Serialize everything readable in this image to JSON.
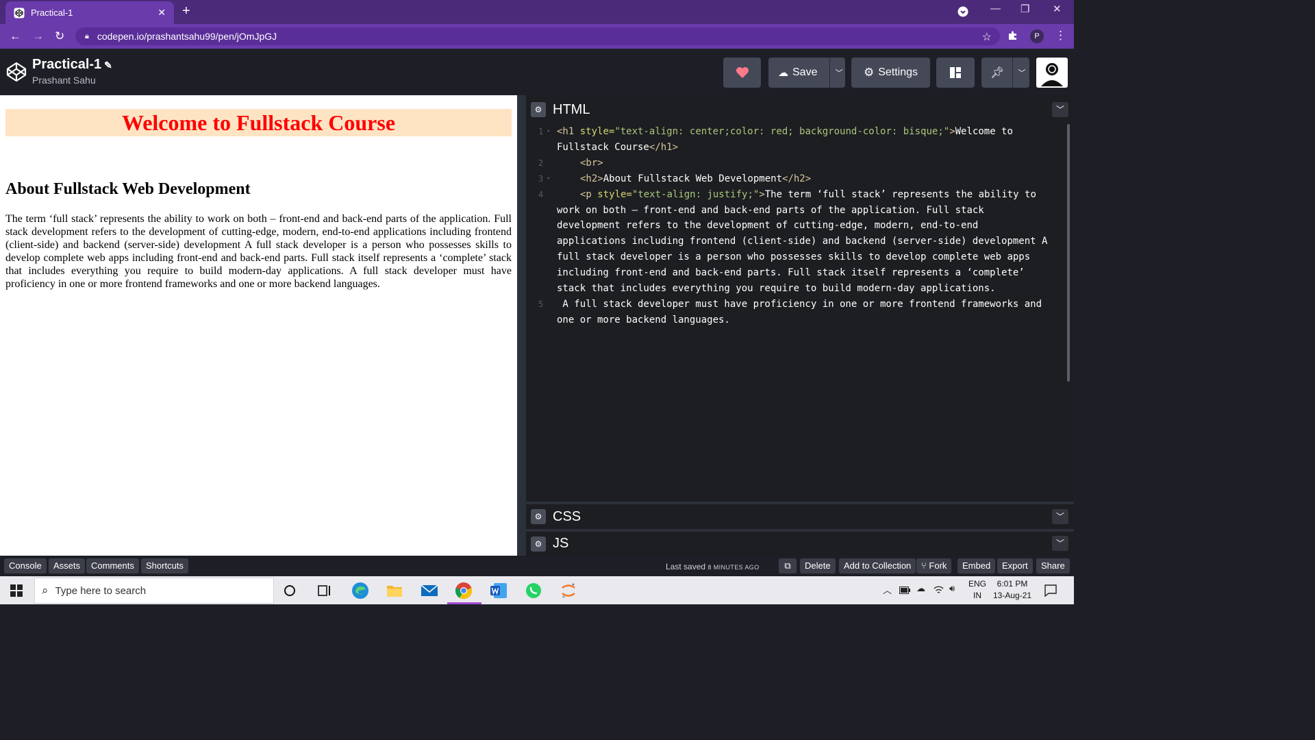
{
  "browser": {
    "tab_title": "Practical-1",
    "tab_close": "✕",
    "new_tab": "+",
    "url": "codepen.io/prashantsahu99/pen/jOmJpGJ",
    "profile_initial": "P",
    "window_controls": [
      "—",
      "❐",
      "✕"
    ]
  },
  "codepen": {
    "pen_title": "Practical-1",
    "author": "Prashant Sahu",
    "buttons": {
      "save": "Save",
      "settings": "Settings"
    }
  },
  "preview": {
    "h1": "Welcome to Fullstack Course",
    "h2": "About Fullstack Web Development",
    "paragraph": "The term ‘full stack’ represents the ability to work on both – front-end and back-end parts of the application. Full stack development refers to the development of cutting-edge, modern, end-to-end applications including frontend (client-side) and backend (server-side) development A full stack developer is a person who possesses skills to develop complete web apps including front-end and back-end parts. Full stack itself represents a ‘complete’ stack that includes everything you require to build modern-day applications. A full stack developer must have proficiency in one or more frontend frameworks and one or more backend languages."
  },
  "editor": {
    "panels": [
      "HTML",
      "CSS",
      "JS"
    ],
    "line_numbers": [
      "1",
      "2",
      "3",
      "4",
      "5"
    ],
    "code": {
      "l1a_tag": "<h1",
      "l1a_attr": " style=",
      "l1a_val": "\"text-align: center;color: red; background-color: bisque;\"",
      "l1a_close": ">",
      "l1a_text": "Welcome to",
      "l1b_text": "Fullstack Course",
      "l1b_tag": "</h1>",
      "l2": "<br>",
      "l3_open": "<h2>",
      "l3_text": "About Fullstack Web Development",
      "l3_close": "</h2>",
      "l4_tag": "<p",
      "l4_attr": " style=",
      "l4_val": "\"text-align: justify;\"",
      "l4_close": ">",
      "l4_text": "The term ‘full stack’ represents the ability to",
      "w1": "work on both – front-end and back-end parts of the application. Full stack",
      "w2": "development refers to the development of cutting-edge, modern, end-to-end",
      "w3": "applications including frontend (client-side) and backend (server-side) development A",
      "w4": "full stack developer is a person who possesses skills to develop complete web apps",
      "w5": "including front-end and back-end parts. Full stack itself represents a ‘complete’",
      "w6": "stack that includes everything you require to build modern-day applications.",
      "l5": " A full stack developer must have proficiency in one or more frontend frameworks and",
      "w7": "one or more backend languages."
    }
  },
  "bottombar": {
    "left_buttons": [
      "Console",
      "Assets",
      "Comments",
      "Shortcuts"
    ],
    "last_saved": "Last saved",
    "ago": "8 MINUTES AGO",
    "right_buttons": [
      "Delete",
      "Add to Collection",
      "Fork",
      "Embed",
      "Export",
      "Share"
    ]
  },
  "taskbar": {
    "search_placeholder": "Type here to search",
    "language": "ENG",
    "region": "IN",
    "time": "6:01 PM",
    "date": "13-Aug-21"
  },
  "colors": {
    "accent_purple": "#6a3bab",
    "preview_heading": "#ff0000",
    "bisque": "#ffe4c4"
  }
}
